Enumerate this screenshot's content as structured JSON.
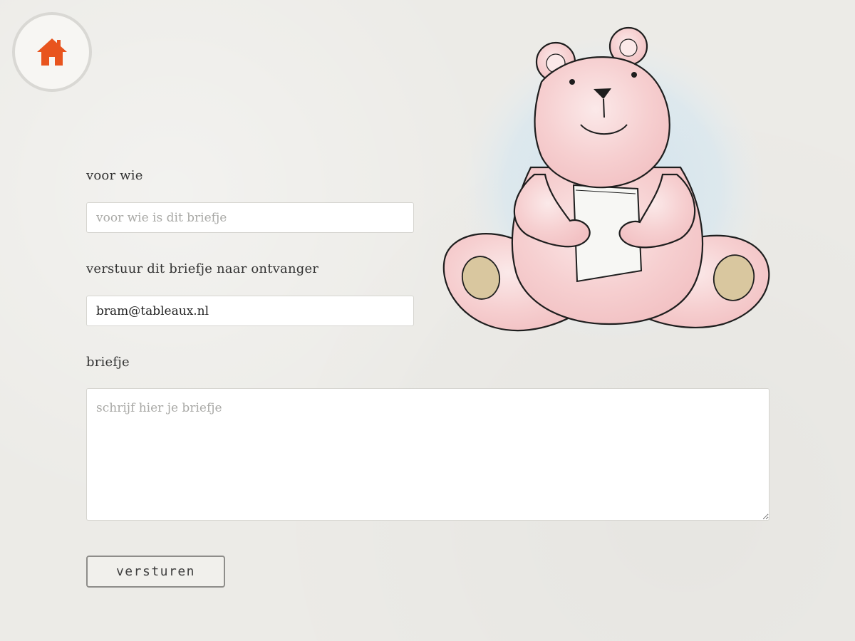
{
  "header": {
    "home_icon": "home-icon",
    "home_color": "#e8541e"
  },
  "form": {
    "recipient_name": {
      "label": "voor wie",
      "value": "",
      "placeholder": "voor wie is dit briefje"
    },
    "recipient_email": {
      "label": "verstuur dit briefje naar ontvanger",
      "value": "bram@tableaux.nl",
      "placeholder": ""
    },
    "note": {
      "label": "briefje",
      "value": "",
      "placeholder": "schrijf hier je briefje"
    },
    "submit_label": "versturen"
  },
  "illustration": {
    "name": "teddy-bear-holding-note",
    "bear_color": "#f7d3d3",
    "paw_color": "#d9c79f",
    "backdrop_color": "#cfe2ee"
  }
}
